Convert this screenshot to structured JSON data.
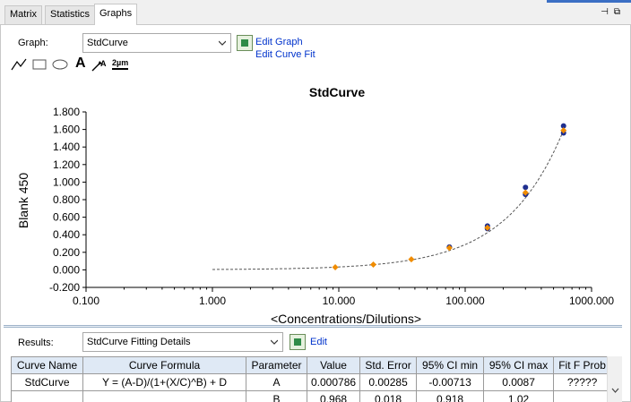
{
  "tabs": [
    "Matrix",
    "Statistics",
    "Graphs"
  ],
  "window_buttons": {
    "pin": "⊣",
    "restore": "⧉"
  },
  "graph_label": "Graph:",
  "graph_select": "StdCurve",
  "edit_graph": "Edit Graph",
  "edit_curve_fit": "Edit Curve Fit",
  "toolbar": {
    "tools": [
      "line-tool-icon",
      "rectangle-tool-icon",
      "ellipse-tool-icon",
      "text-tool-icon",
      "arrow-text-tool-icon",
      "dimension-tool-icon"
    ],
    "text_tool_glyph": "A",
    "dimension_tool_glyph": "2µm"
  },
  "results_label": "Results:",
  "results_select": "StdCurve Fitting Details",
  "results_edit": "Edit",
  "table": {
    "headers": [
      "Curve Name",
      "Curve Formula",
      "Parameter",
      "Value",
      "Std. Error",
      "95% CI min",
      "95% CI max",
      "Fit F Prob"
    ],
    "rows": [
      [
        "StdCurve",
        "Y = (A-D)/(1+(X/C)^B) + D",
        "A",
        "0.000786",
        "0.00285",
        "-0.00713",
        "0.0087",
        "?????"
      ],
      [
        "",
        "",
        "B",
        "0.968",
        "0.018",
        "0.918",
        "1.02",
        ""
      ]
    ]
  },
  "chart_data": {
    "type": "scatter",
    "title": "StdCurve",
    "xlabel": "<Concentrations/Dilutions>",
    "ylabel": "Blank 450",
    "x_scale": "log",
    "xlim": [
      0.1,
      1000
    ],
    "ylim": [
      -0.2,
      1.8
    ],
    "x_ticks": [
      "0.100",
      "1.000",
      "10.000",
      "100.000",
      "1000.000"
    ],
    "y_ticks": [
      "-0.200",
      "0.000",
      "0.200",
      "0.400",
      "0.600",
      "0.800",
      "1.000",
      "1.200",
      "1.400",
      "1.600",
      "1.800"
    ],
    "grid": false,
    "colors": {
      "standard": "#f08c00",
      "replicate": "#1f2f8f",
      "fit_line": "#555555"
    },
    "series": [
      {
        "marker": "orange-diamond",
        "x": [
          9.375,
          18.75,
          37.5,
          75,
          150,
          300,
          600
        ],
        "y": [
          0.03,
          0.06,
          0.12,
          0.25,
          0.48,
          0.88,
          1.59
        ]
      },
      {
        "marker": "blue-circle",
        "x": [
          75,
          150,
          150,
          300,
          300,
          600,
          600
        ],
        "y": [
          0.26,
          0.47,
          0.5,
          0.86,
          0.94,
          1.56,
          1.64
        ]
      }
    ],
    "fit_curve": {
      "formula": "Y = (A-D)/(1+(X/C)^B) + D",
      "x_range": [
        1,
        600
      ],
      "B": 0.968,
      "A": 0.000786
    }
  }
}
